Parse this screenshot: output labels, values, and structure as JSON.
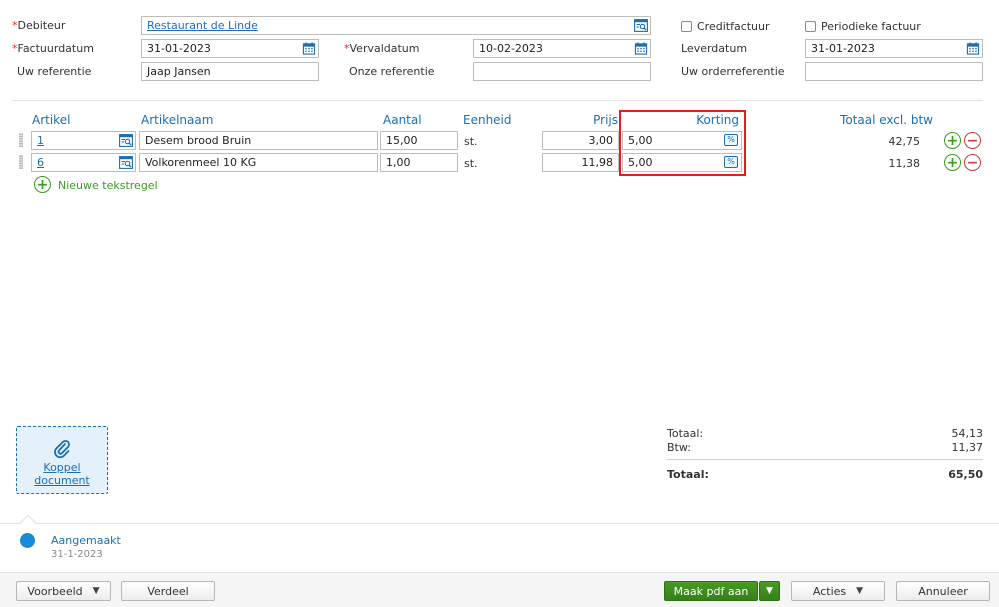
{
  "header": {
    "debiteur_label": "Debiteur",
    "debiteur_value": "Restaurant de Linde",
    "creditfactuur_label": "Creditfactuur",
    "periodieke_label": "Periodieke factuur",
    "factuurdatum_label": "Factuurdatum",
    "factuurdatum_value": "31-01-2023",
    "vervaldatum_label": "Vervaldatum",
    "vervaldatum_value": "10-02-2023",
    "leverdatum_label": "Leverdatum",
    "leverdatum_value": "31-01-2023",
    "uw_referentie_label": "Uw referentie",
    "uw_referentie_value": "Jaap Jansen",
    "onze_referentie_label": "Onze referentie",
    "onze_referentie_value": "",
    "uw_orderreferentie_label": "Uw orderreferentie",
    "uw_orderreferentie_value": "",
    "required_mark": "*"
  },
  "lines": {
    "columns": {
      "artikel": "Artikel",
      "artikelnaam": "Artikelnaam",
      "aantal": "Aantal",
      "eenheid": "Eenheid",
      "prijs": "Prijs",
      "korting": "Korting",
      "totaal": "Totaal excl. btw"
    },
    "rows": [
      {
        "artikel": "1",
        "artikelnaam": "Desem brood Bruin",
        "aantal": "15,00",
        "eenheid": "st.",
        "prijs": "3,00",
        "korting": "5,00",
        "totaal": "42,75"
      },
      {
        "artikel": "6",
        "artikelnaam": "Volkorenmeel 10 KG",
        "aantal": "1,00",
        "eenheid": "st.",
        "prijs": "11,98",
        "korting": "5,00",
        "totaal": "11,38"
      }
    ],
    "percent_symbol": "%",
    "new_text_line": "Nieuwe tekstregel"
  },
  "attachment": {
    "label": "Koppel document"
  },
  "summary": {
    "totaal_label": "Totaal:",
    "totaal_value": "54,13",
    "btw_label": "Btw:",
    "btw_value": "11,37",
    "grand_label": "Totaal:",
    "grand_value": "65,50"
  },
  "timeline": {
    "status": "Aangemaakt",
    "date": "31-1-2023"
  },
  "footer": {
    "voorbeeld": "Voorbeeld",
    "verdeel": "Verdeel",
    "maak_pdf": "Maak pdf aan",
    "acties": "Acties",
    "annuleer": "Annuleer"
  },
  "colors": {
    "accent": "#1a6fb3",
    "primary_button": "#3d8a1c",
    "highlight": "#e0201c"
  }
}
